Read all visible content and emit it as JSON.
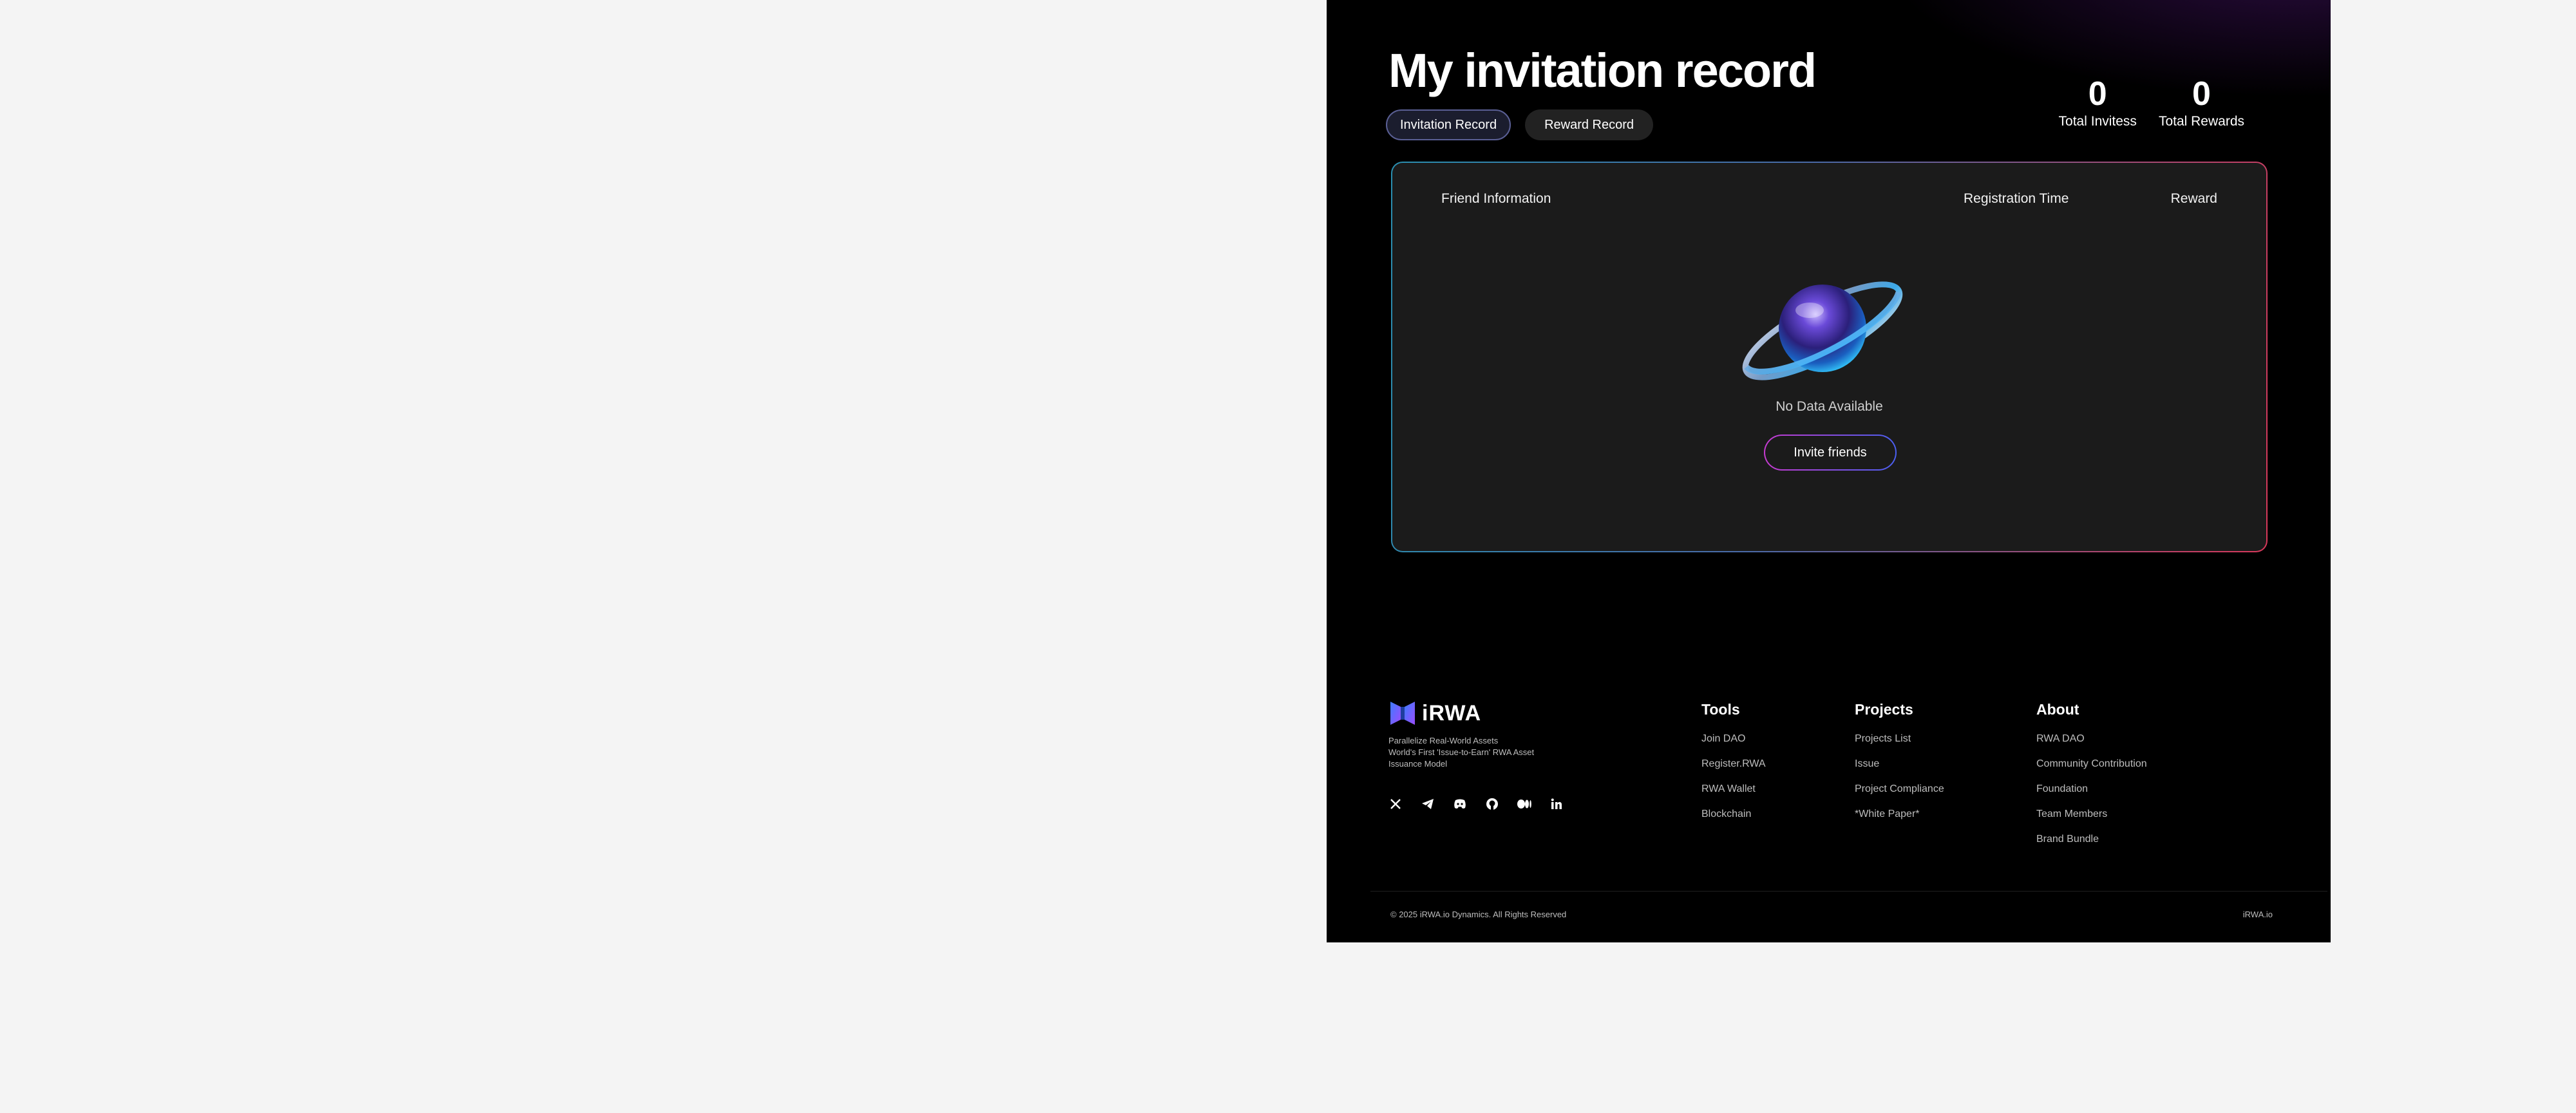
{
  "header": {
    "title": "My invitation record",
    "tabs": [
      {
        "label": "Invitation Record",
        "active": true
      },
      {
        "label": "Reward Record",
        "active": false
      }
    ]
  },
  "stats": [
    {
      "value": "0",
      "label": "Total Invitess"
    },
    {
      "value": "0",
      "label": "Total Rewards"
    }
  ],
  "table": {
    "columns": [
      "Friend Information",
      "Registration Time",
      "Reward"
    ],
    "empty_text": "No Data Available",
    "invite_button": "Invite friends"
  },
  "footer": {
    "brand": "iRWA",
    "tagline_lines": [
      "Parallelize Real-World Assets",
      "World's First 'Issue-to-Earn' RWA Asset",
      "Issuance Model"
    ],
    "socials": [
      "x-icon",
      "telegram-icon",
      "discord-icon",
      "github-icon",
      "medium-icon",
      "linkedin-icon"
    ],
    "columns": [
      {
        "title": "Tools",
        "links": [
          "Join DAO",
          "Register.RWA",
          "RWA Wallet",
          "Blockchain"
        ]
      },
      {
        "title": "Projects",
        "links": [
          "Projects List",
          "Issue",
          "Project Compliance",
          "*White Paper*"
        ]
      },
      {
        "title": "About",
        "links": [
          "RWA DAO",
          "Community Contribution",
          "Foundation",
          "Team Members",
          "Brand Bundle"
        ]
      }
    ],
    "copyright": "© 2025 iRWA.io Dynamics. All Rights Reserved",
    "site": "iRWA.io"
  },
  "colors": {
    "background": "#000000",
    "outer_background": "#f4f4f4",
    "panel_background": "#1b1b1b",
    "accent_blue": "#2a8fb0",
    "accent_red": "#d8385a",
    "invite_gradient_start": "#c63bd0",
    "invite_gradient_end": "#4a5ff0"
  }
}
